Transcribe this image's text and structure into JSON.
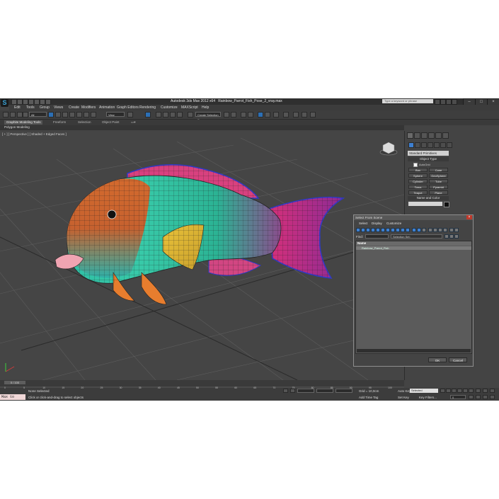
{
  "titlebar": {
    "app_title": "Autodesk 3ds Max  2012 x64",
    "file_name": "Rainbow_Parrot_Fish_Pose_2_vray.max",
    "search_placeholder": "Type a keyword or phrase"
  },
  "menubar": {
    "items": [
      "Edit",
      "Tools",
      "Group",
      "Views",
      "Create",
      "Modifiers",
      "Animation",
      "Graph Editors",
      "Rendering",
      "Customize",
      "MAXScript",
      "Help"
    ]
  },
  "toolbar": {
    "filter_value": "All",
    "view_value": "View",
    "selection_set": "Create Selection Se"
  },
  "ribbon": {
    "tabs": [
      "Graphite Modeling Tools",
      "Freeform",
      "Selection",
      "Object Paint"
    ],
    "sub_label": "Polygon Modeling"
  },
  "viewport": {
    "label": "[ + ] [ Perspective ] [ Shaded + Edged Faces ]",
    "accent_colors": {
      "teal": "#2fbfa5",
      "orange": "#e0602a",
      "magenta": "#d23a8e",
      "yellow": "#e6c23a"
    }
  },
  "command_panel": {
    "dropdown": "Standard Primitives",
    "object_type_header": "Object Type",
    "autogrid_label": "AutoGrid",
    "buttons": [
      "Box",
      "Cone",
      "Sphere",
      "GeoSphere",
      "Cylinder",
      "Tube",
      "Torus",
      "Pyramid",
      "Teapot",
      "Plane"
    ],
    "name_color_header": "Name and Color"
  },
  "dialog": {
    "title": "Select From Scene",
    "menu": [
      "Select",
      "Display",
      "Customize"
    ],
    "find_label": "Find:",
    "selection_set_label": "Selection Set:",
    "column_name": "Name",
    "items": [
      "Rainbow_Parrot_Fish"
    ],
    "ok": "OK",
    "cancel": "Cancel"
  },
  "timeline": {
    "slider": "0 / 100",
    "ticks": [
      "0",
      "5",
      "10",
      "15",
      "20",
      "25",
      "30",
      "35",
      "40",
      "45",
      "50",
      "55",
      "60",
      "65",
      "70",
      "75",
      "80",
      "85",
      "90",
      "95",
      "100"
    ]
  },
  "status": {
    "maxscript": "Max to Physc",
    "selection": "None Selected",
    "prompt": "Click or click-and-drag to select objects",
    "grid": "Grid = 10,0cm",
    "add_time_tag": "Add Time Tag",
    "auto_key": "Auto Key",
    "auto_key_value": "Selected",
    "set_key": "Set Key",
    "key_filters": "Key Filters...",
    "frame": "0"
  }
}
